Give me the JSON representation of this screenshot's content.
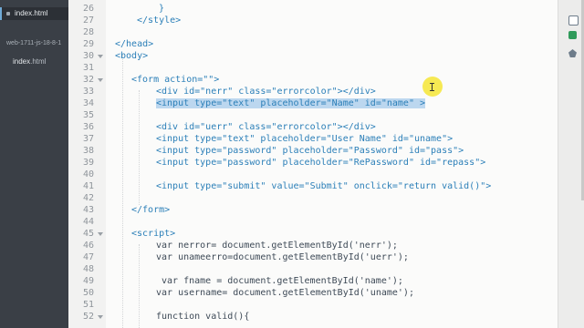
{
  "sidebar": {
    "open_file": "index.html",
    "project": "web-1711-js-18-8-1",
    "file_name": "index",
    "file_ext": ".html"
  },
  "line_numbers": [
    "26",
    "27",
    "28",
    "29",
    "30",
    "31",
    "32",
    "33",
    "34",
    "35",
    "36",
    "37",
    "38",
    "39",
    "40",
    "41",
    "42",
    "43",
    "44",
    "45",
    "46",
    "47",
    "48",
    "49",
    "50",
    "51",
    "52"
  ],
  "code": {
    "l26": "}",
    "l27": "</style>",
    "l29": "</head>",
    "l30": "<body>",
    "l32": "<form action=\"\">",
    "l33": "<div id=\"nerr\" class=\"errorcolor\"></div>",
    "l34": "<input type=\"text\" placeholder=\"Name\" id=\"name\" >",
    "l36": "<div id=\"uerr\" class=\"errorcolor\"></div>",
    "l37": "<input type=\"text\" placeholder=\"User Name\" id=\"uname\">",
    "l38": "<input type=\"password\" placeholder=\"Password\" id=\"pass\">",
    "l39": "<input type=\"password\" placeholder=\"RePassword\" id=\"repass\">",
    "l41": "<input type=\"submit\" value=\"Submit\" onclick=\"return valid()\">",
    "l43": "</form>",
    "l45": "<script>",
    "l46": "var nerror= document.getElementById('nerr');",
    "l47": "var unameerro=document.getElementById('uerr');",
    "l49": "var fname = document.getElementById('name');",
    "l50": "var username= document.getElementById('uname');",
    "l52": "function valid(){"
  },
  "icons": [
    "file-icon",
    "git-icon",
    "extension-icon"
  ]
}
